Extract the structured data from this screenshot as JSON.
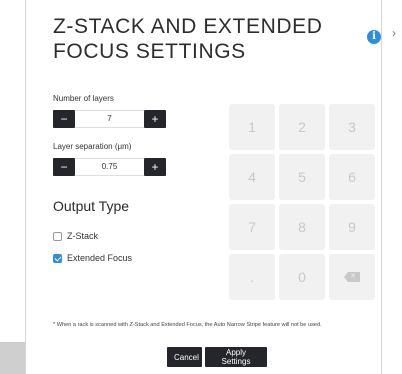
{
  "dialog": {
    "title": "Z-STACK AND EXTENDED FOCUS SETTINGS",
    "info_icon_glyph": "i",
    "next_chevron_glyph": "›"
  },
  "layers": {
    "label": "Number of layers",
    "value": "7",
    "minus": "−",
    "plus": "+"
  },
  "separation": {
    "label": "Layer separation (μm)",
    "value": "0.75",
    "minus": "−",
    "plus": "+"
  },
  "output": {
    "title": "Output Type",
    "options": [
      {
        "label": "Z-Stack",
        "checked": false
      },
      {
        "label": "Extended Focus",
        "checked": true
      }
    ]
  },
  "keypad": {
    "keys": [
      "1",
      "2",
      "3",
      "4",
      "5",
      "6",
      "7",
      "8",
      "9",
      ".",
      "0"
    ],
    "backspace_icon": "backspace-icon"
  },
  "footnote": "* When a rack is scanned with Z-Stack and Extended Focus, the Auto Narrow Stripe feature will not be used.",
  "footer": {
    "cancel": "Cancel",
    "apply": "Apply Settings"
  },
  "background": {
    "ghost_text": "5"
  },
  "colors": {
    "accent": "#2d8fd9",
    "button_dark": "#25262b",
    "key_bg": "#f1f1f1"
  }
}
